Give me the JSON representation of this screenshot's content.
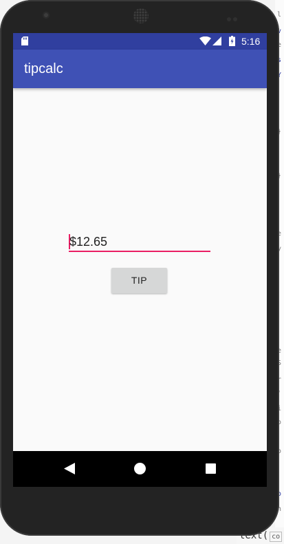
{
  "statusbar": {
    "time": "5:16",
    "color": "#303f9f"
  },
  "appbar": {
    "title": "tipcalc",
    "color": "#3f51b5"
  },
  "amount_input": {
    "value": "$12.65",
    "accent_color": "#e91e63"
  },
  "tip_button": {
    "label": "TIP"
  },
  "navbar": {
    "back_icon": "back-triangle",
    "home_icon": "home-circle",
    "recents_icon": "recents-square"
  },
  "code_editor": {
    "margin_chars": [
      "l",
      "v",
      "e",
      "s",
      "Y",
      "}",
      "}",
      "e",
      "y",
      "e",
      "S",
      "r",
      "'",
      "i",
      "o",
      "o",
      "o",
      "n"
    ],
    "bottom_line": "text(",
    "hint": "co"
  }
}
